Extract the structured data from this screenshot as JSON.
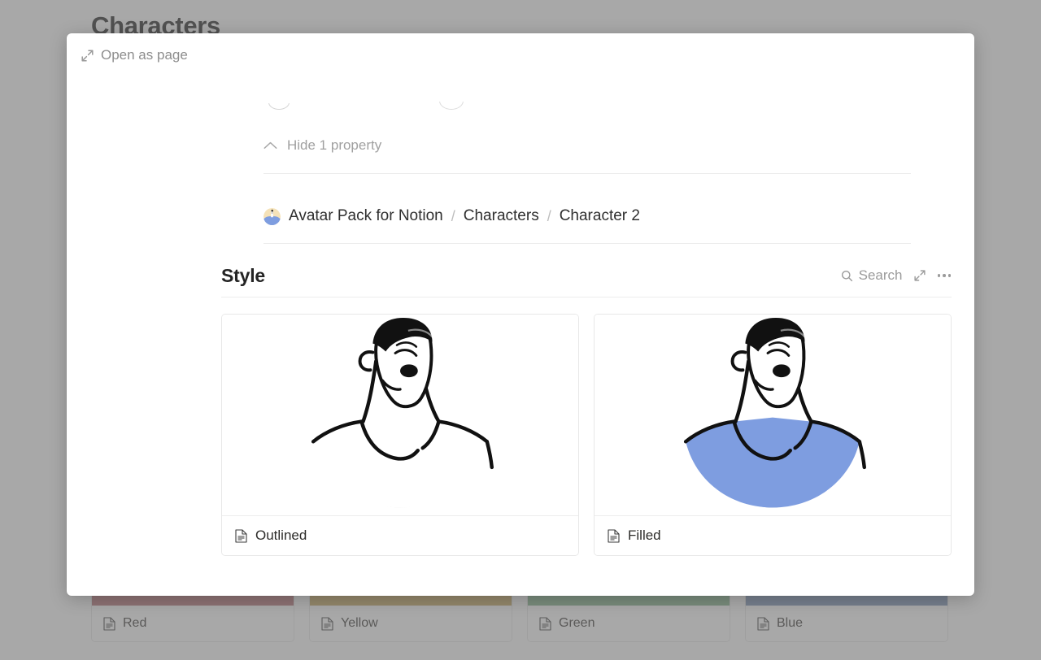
{
  "background": {
    "title": "Characters",
    "cards": [
      {
        "label": "Red",
        "icon": "page-icon",
        "swatch": "#b56f73"
      },
      {
        "label": "Yellow",
        "icon": "page-icon",
        "swatch": "#c4a65c"
      },
      {
        "label": "Green",
        "icon": "page-icon",
        "swatch": "#82b389"
      },
      {
        "label": "Blue",
        "icon": "page-icon",
        "swatch": "#7a90b5"
      }
    ]
  },
  "modal": {
    "open_as_page": {
      "label": "Open as page",
      "icon": "expand-diagonal-icon"
    },
    "properties_toggle": {
      "label": "Hide 1 property",
      "icon": "chevron-up-icon"
    },
    "breadcrumb": {
      "avatar_icon": "avatar-icon",
      "items": [
        {
          "label": "Avatar Pack for Notion"
        },
        {
          "label": "Characters"
        },
        {
          "label": "Character 2"
        }
      ],
      "separator": "/"
    },
    "gallery": {
      "title": "Style",
      "search": {
        "label": "Search",
        "icon": "search-icon"
      },
      "expand": {
        "icon": "expand-diagonal-icon"
      },
      "more": {
        "icon": "ellipsis-icon"
      },
      "cards": [
        {
          "label": "Outlined",
          "icon": "page-icon",
          "shirt_color": "#ffffff",
          "shirt_shadow": "#e3e3e3",
          "outline_color": "#111111"
        },
        {
          "label": "Filled",
          "icon": "page-icon",
          "shirt_color": "#7e9de0",
          "shirt_shadow": "#6a87c9",
          "outline_color": "#111111"
        }
      ]
    }
  },
  "colors": {
    "overlay": "#737373",
    "modal_bg": "#ffffff",
    "border": "#e8e8e8",
    "muted_text": "#9b9b9b",
    "accent_blue": "#7e9de0"
  }
}
